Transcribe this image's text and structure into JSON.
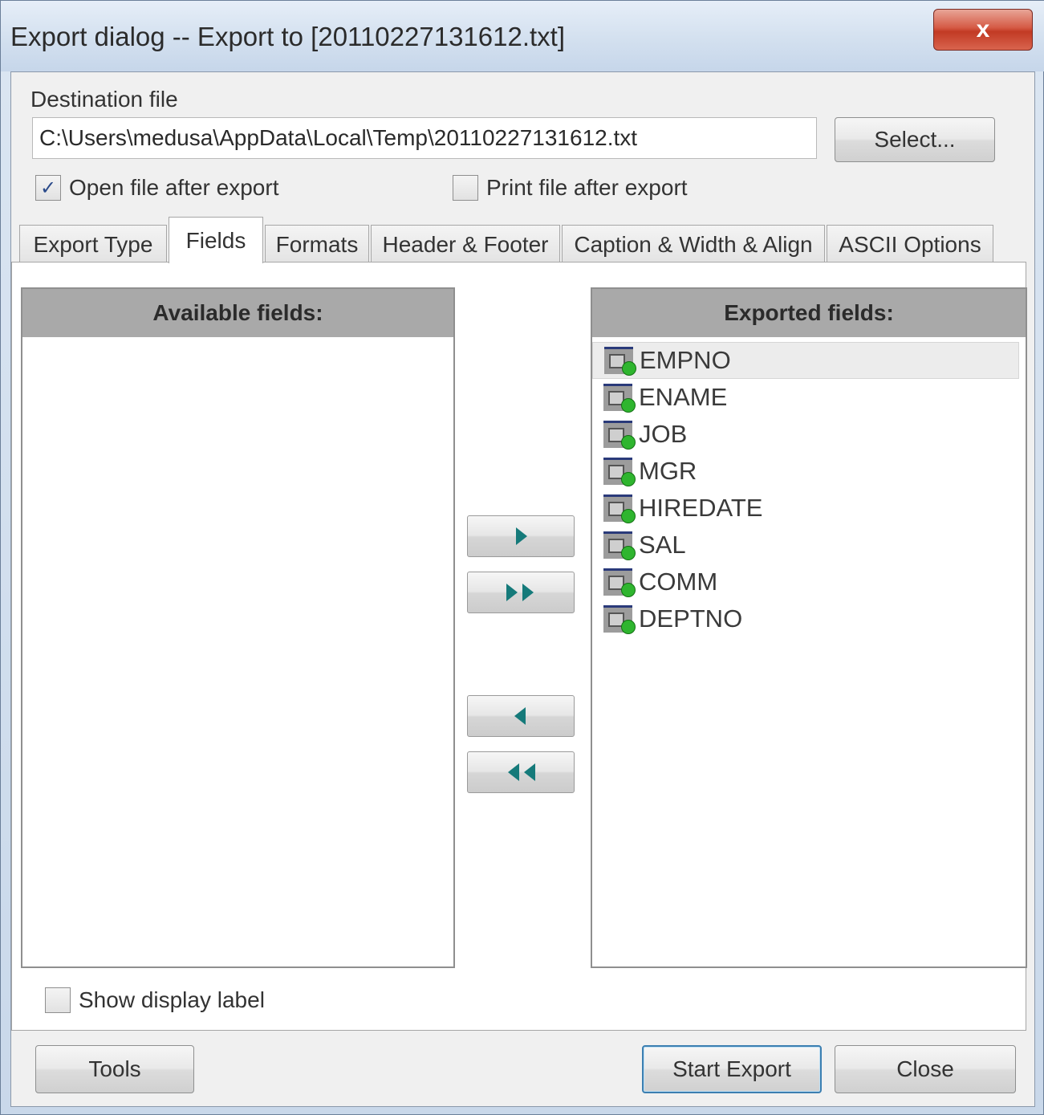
{
  "window": {
    "title": "Export dialog -- Export to [20110227131612.txt]",
    "close_glyph": "x"
  },
  "destination": {
    "label": "Destination file",
    "path": "C:\\Users\\medusa\\AppData\\Local\\Temp\\20110227131612.txt",
    "select_label": "Select..."
  },
  "options": {
    "open_after": {
      "label": "Open file after export",
      "checked": true
    },
    "print_after": {
      "label": "Print file after export",
      "checked": false
    }
  },
  "tabs": [
    {
      "label": "Export Type",
      "active": false
    },
    {
      "label": "Fields",
      "active": true
    },
    {
      "label": "Formats",
      "active": false
    },
    {
      "label": "Header & Footer",
      "active": false
    },
    {
      "label": "Caption & Width & Align",
      "active": false
    },
    {
      "label": "ASCII Options",
      "active": false
    }
  ],
  "fields": {
    "available_header": "Available fields:",
    "exported_header": "Exported fields:",
    "available": [],
    "exported": [
      "EMPNO",
      "ENAME",
      "JOB",
      "MGR",
      "HIREDATE",
      "SAL",
      "COMM",
      "DEPTNO"
    ],
    "selected_exported": "EMPNO",
    "show_display_label": {
      "label": "Show display label",
      "checked": false
    }
  },
  "buttons": {
    "tools": "Tools",
    "start_export": "Start Export",
    "close": "Close"
  },
  "icons": {
    "field": "field-icon",
    "move_right": "arrow-right-icon",
    "move_all_right": "double-arrow-right-icon",
    "move_left": "arrow-left-icon",
    "move_all_left": "double-arrow-left-icon"
  },
  "colors": {
    "titlebar": "#d3e0ef",
    "close_button": "#c23a24",
    "list_header": "#a9a9a9",
    "arrow": "#157a7a",
    "field_status_dot": "#2fb52f"
  }
}
